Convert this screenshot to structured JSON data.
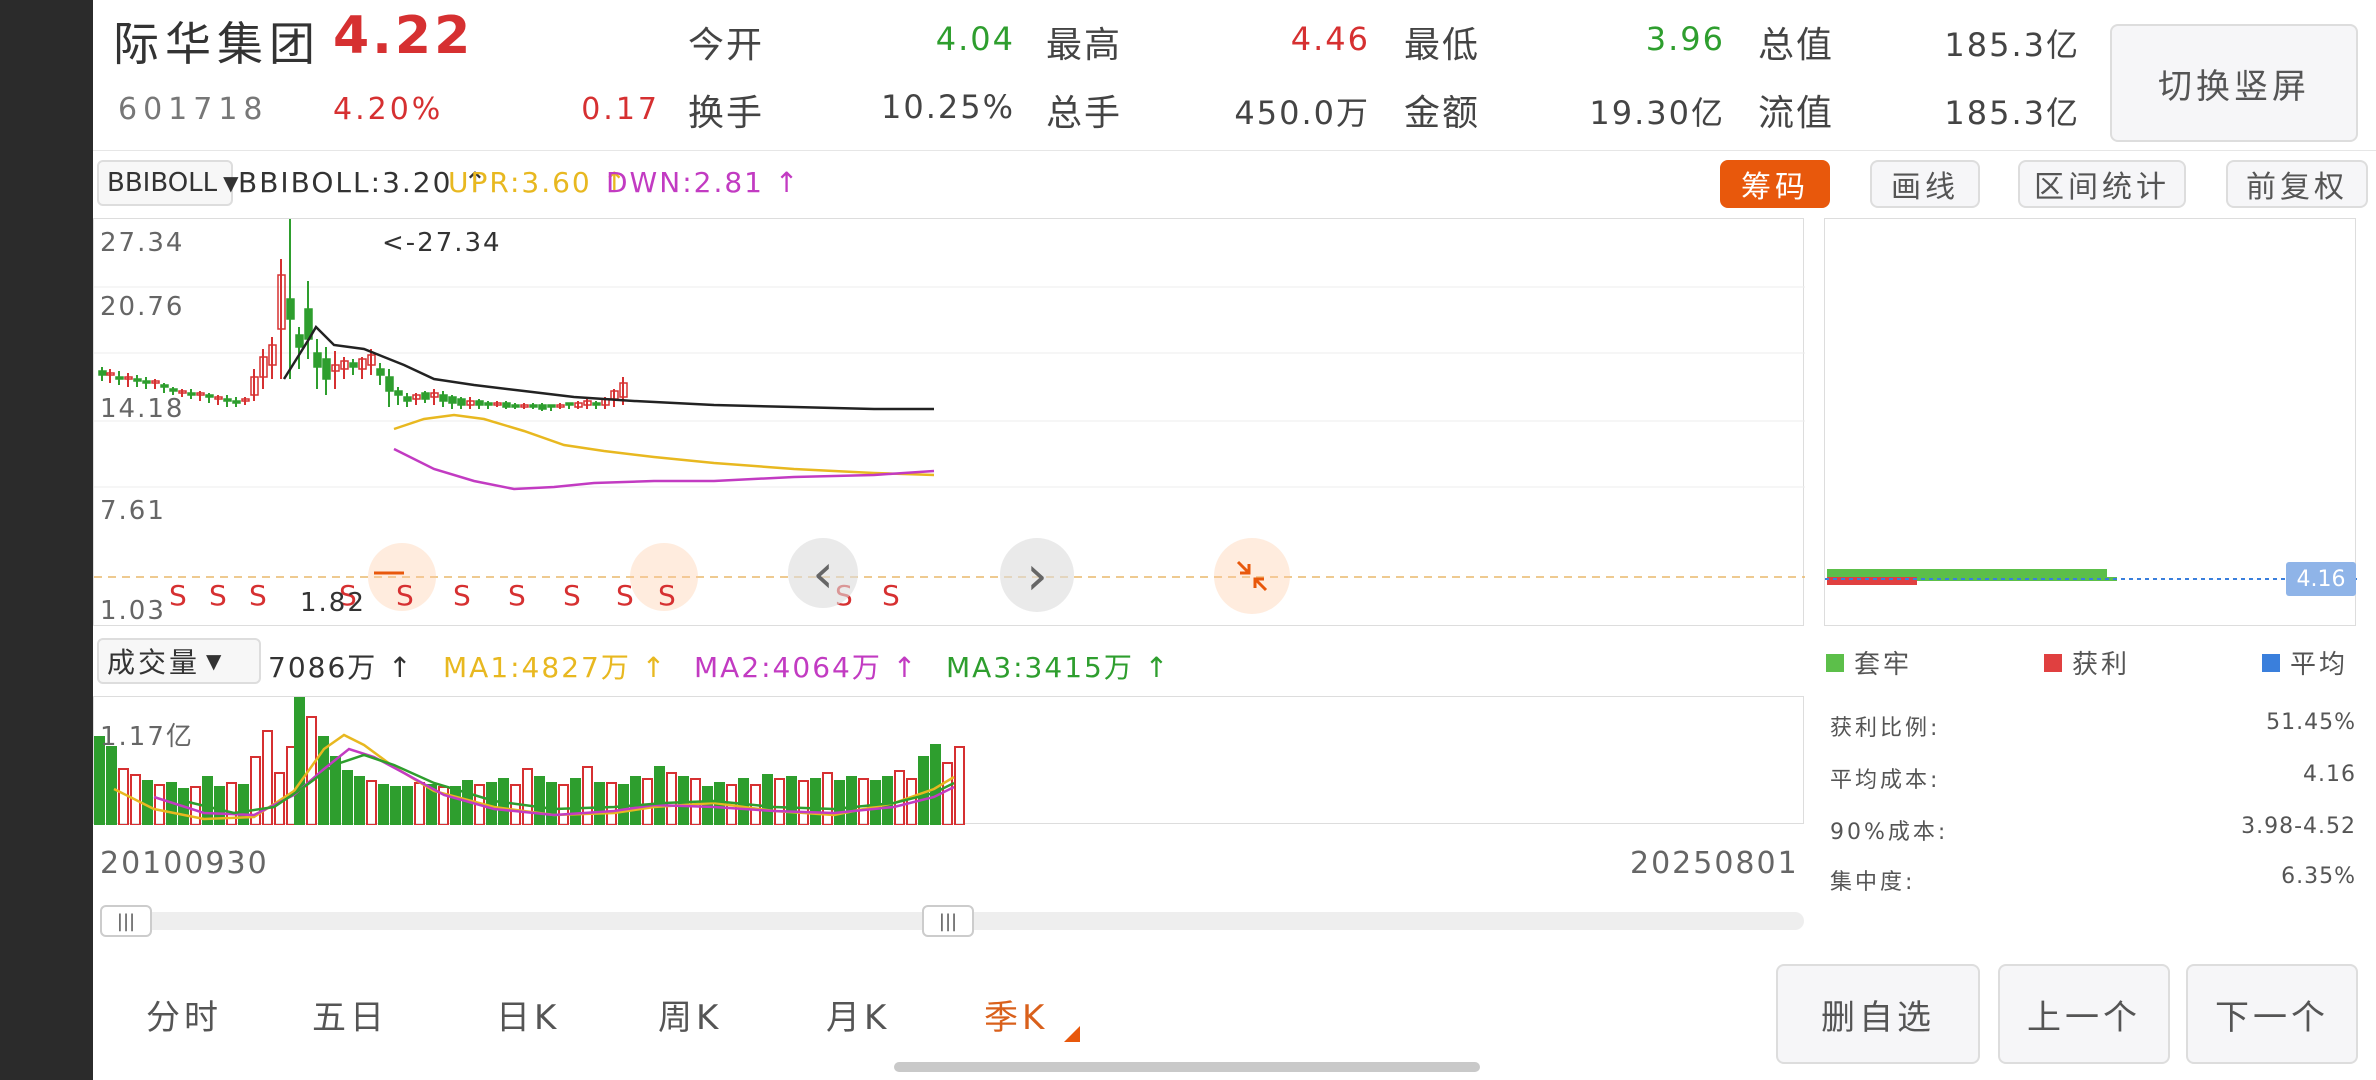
{
  "header": {
    "stock_name": "际华集团",
    "price": "4.22",
    "code": "601718",
    "change_pct": "4.20%",
    "change_amt": "0.17",
    "quote_row1": [
      {
        "label": "今开",
        "value": "4.04",
        "color": "green"
      },
      {
        "label": "最高",
        "value": "4.46",
        "color": "red"
      },
      {
        "label": "最低",
        "value": "3.96",
        "color": "green"
      },
      {
        "label": "总值",
        "value": "185.3亿",
        "color": "dark"
      }
    ],
    "quote_row2": [
      {
        "label": "换手",
        "value": "10.25%",
        "color": "dark"
      },
      {
        "label": "总手",
        "value": "450.0万",
        "color": "dark"
      },
      {
        "label": "金额",
        "value": "19.30亿",
        "color": "dark"
      },
      {
        "label": "流值",
        "value": "185.3亿",
        "color": "dark"
      }
    ],
    "switch_button": "切换竖屏"
  },
  "indicator_bar": {
    "selector": "BBIBOLL",
    "bbiboll": "BBIBOLL:3.20 ↑",
    "upr": "UPR:3.60 ↑",
    "dwn": "DWN:2.81 ↑",
    "buttons": [
      "筹码",
      "画线",
      "区间统计",
      "前复权"
    ]
  },
  "main_chart": {
    "y_labels": [
      "27.34",
      "20.76",
      "14.18",
      "7.61",
      "1.03"
    ],
    "max_annotation": "<-27.34",
    "min_annotation": "1.82",
    "signal_marker": "S",
    "nav_prev": "‹",
    "nav_next": "›",
    "chip_price": "4.16"
  },
  "volume_bar": {
    "selector": "成交量",
    "vol": "7086万 ↑",
    "ma1": "MA1:4827万 ↑",
    "ma2": "MA2:4064万 ↑",
    "ma3": "MA3:3415万 ↑",
    "y_label": "1.17亿"
  },
  "date_axis": {
    "start": "20100930",
    "end": "20250801"
  },
  "chip_panel": {
    "legend": [
      "套牢",
      "获利",
      "平均"
    ],
    "stats": [
      {
        "label": "获利比例:",
        "value": "51.45%"
      },
      {
        "label": "平均成本:",
        "value": "4.16"
      },
      {
        "label": "90%成本:",
        "value": "3.98-4.52"
      },
      {
        "label": "集中度:",
        "value": "6.35%"
      }
    ]
  },
  "period_tabs": [
    "分时",
    "五日",
    "日K",
    "周K",
    "月K",
    "季K"
  ],
  "active_tab": "季K",
  "bottom_buttons": [
    "删自选",
    "上一个",
    "下一个"
  ],
  "colors": {
    "up": "#d63031",
    "down": "#2e9e2e",
    "upr": "#e8b820",
    "dwn": "#c23bc2",
    "accent": "#e8580c",
    "ma1": "#e8b820",
    "ma2": "#c23bc2",
    "ma3": "#2e9e2e"
  },
  "icons": {
    "dropdown": "triangle-down-icon",
    "collapse": "collapse-arrows-icon",
    "slider": "grip-icon"
  }
}
